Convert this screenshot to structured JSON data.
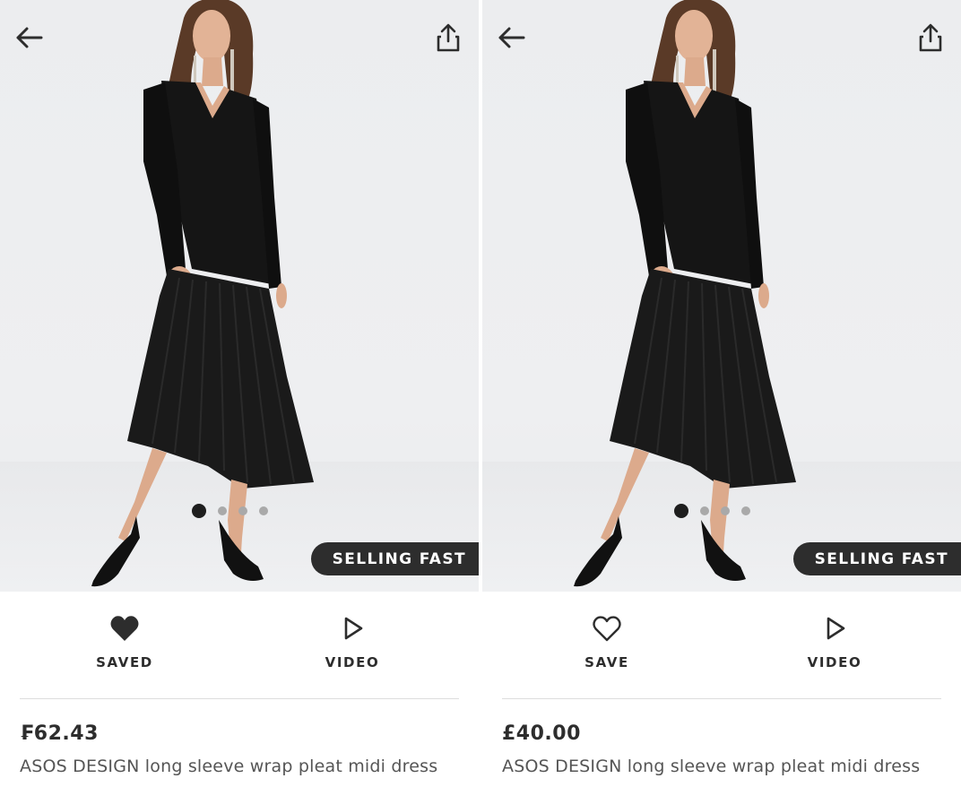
{
  "panels": [
    {
      "badge": "SELLING FAST",
      "carousel": {
        "count": 4,
        "active": 1
      },
      "save": {
        "label": "SAVED",
        "icon": "heart-filled-icon",
        "state": "saved"
      },
      "video": {
        "label": "VIDEO",
        "icon": "play-icon"
      },
      "price": "₣62.43",
      "product_title": "ASOS DESIGN long sleeve wrap pleat midi dress"
    },
    {
      "badge": "SELLING FAST",
      "carousel": {
        "count": 4,
        "active": 1
      },
      "save": {
        "label": "SAVE",
        "icon": "heart-outline-icon",
        "state": "not-saved"
      },
      "video": {
        "label": "VIDEO",
        "icon": "play-icon"
      },
      "price": "£40.00",
      "product_title": "ASOS DESIGN long sleeve wrap pleat midi dress"
    }
  ],
  "icons": {
    "back": "arrow-left-icon",
    "share": "share-icon"
  },
  "colors": {
    "text": "#2d2d2d",
    "badge_bg": "#2d2d2d",
    "dot_active": "#1e1e1e",
    "dot_inactive": "#a9a9a9",
    "background": "#ececee"
  }
}
